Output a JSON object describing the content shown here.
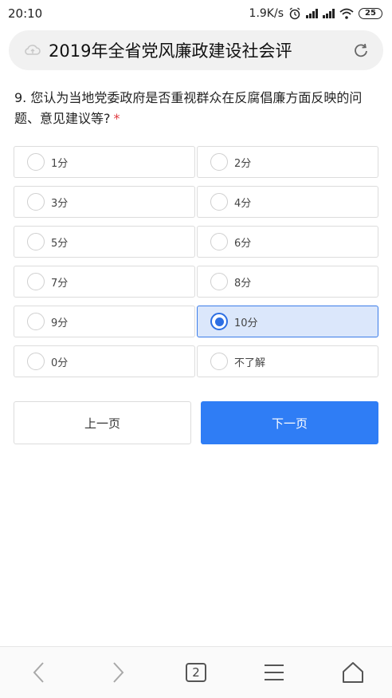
{
  "status_bar": {
    "time": "20:10",
    "speed": "1.9K/s",
    "battery": "25",
    "icons": [
      "alarm-icon",
      "signal-icon",
      "hd-signal-icon",
      "wifi-icon",
      "battery-icon"
    ]
  },
  "browser": {
    "page_title": "2019年全省党风廉政建设社会评",
    "lead_icon": "cloud-sync-icon",
    "reload_icon": "reload-icon"
  },
  "survey": {
    "question": "9. 您认为当地党委政府是否重视群众在反腐倡廉方面反映的问题、意见建议等?",
    "required_mark": "*",
    "options": [
      {
        "label": "1分",
        "selected": false
      },
      {
        "label": "2分",
        "selected": false
      },
      {
        "label": "3分",
        "selected": false
      },
      {
        "label": "4分",
        "selected": false
      },
      {
        "label": "5分",
        "selected": false
      },
      {
        "label": "6分",
        "selected": false
      },
      {
        "label": "7分",
        "selected": false
      },
      {
        "label": "8分",
        "selected": false
      },
      {
        "label": "9分",
        "selected": false
      },
      {
        "label": "10分",
        "selected": true
      },
      {
        "label": "0分",
        "selected": false
      },
      {
        "label": "不了解",
        "selected": false
      }
    ],
    "prev_label": "上一页",
    "next_label": "下一页"
  },
  "bottom_nav": {
    "tab_count": "2"
  },
  "colors": {
    "accent": "#2f7df5",
    "selected_bg": "#dbe7fb",
    "required": "#e0383e"
  }
}
